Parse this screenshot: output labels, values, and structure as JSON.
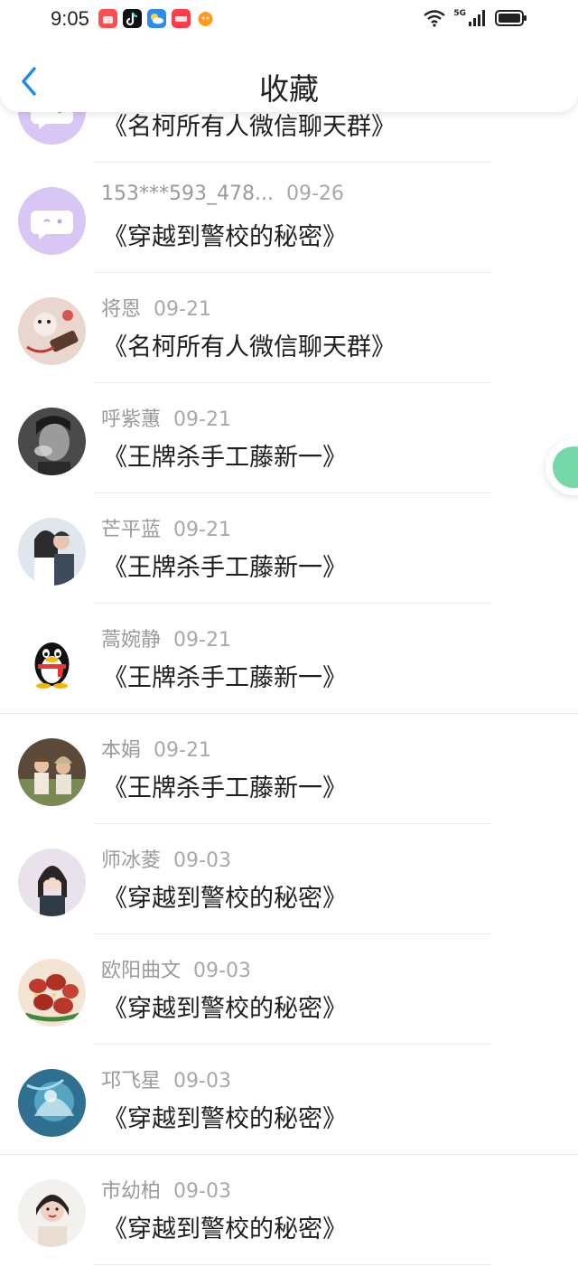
{
  "status_bar": {
    "time": "9:05",
    "network": "5G",
    "apps": [
      {
        "name": "taobao-app-icon",
        "color": "#ff4c4c"
      },
      {
        "name": "tiktok-app-icon",
        "color": "#111111"
      },
      {
        "name": "weather-app-icon",
        "color": "#2b8cf0"
      },
      {
        "name": "tmall-app-icon",
        "color": "#ff3b4a"
      },
      {
        "name": "game-app-icon",
        "color": "#ff9a1f"
      }
    ]
  },
  "header": {
    "title": "收藏"
  },
  "colors": {
    "accent": "#1e8be6",
    "purple_avatar": "#d8c6f5",
    "meta_text": "#9a9a9a"
  },
  "items": [
    {
      "user": "",
      "date": "",
      "text": "《名柯所有人微信聊天群》",
      "avatar": "purple-chat"
    },
    {
      "user": "153***593_478...",
      "date": "09-26",
      "text": "《穿越到警校的秘密》",
      "avatar": "purple-chat"
    },
    {
      "user": "将恩",
      "date": "09-21",
      "text": "《名柯所有人微信聊天群》",
      "avatar": "cartoon"
    },
    {
      "user": "呼紫蕙",
      "date": "09-21",
      "text": "《王牌杀手工藤新一》",
      "avatar": "bw-portrait"
    },
    {
      "user": "芒平蓝",
      "date": "09-21",
      "text": "《王牌杀手工藤新一》",
      "avatar": "couple"
    },
    {
      "user": "蒿婉静",
      "date": "09-21",
      "text": "《王牌杀手工藤新一》",
      "avatar": "qq-penguin"
    },
    {
      "user": "本娟",
      "date": "09-21",
      "text": "《王牌杀手工藤新一》",
      "avatar": "outdoor"
    },
    {
      "user": "师冰菱",
      "date": "09-03",
      "text": "《穿越到警校的秘密》",
      "avatar": "girl-pink"
    },
    {
      "user": "欧阳曲文",
      "date": "09-03",
      "text": "《穿越到警校的秘密》",
      "avatar": "food"
    },
    {
      "user": "邛飞星",
      "date": "09-03",
      "text": "《穿越到警校的秘密》",
      "avatar": "blue-art"
    },
    {
      "user": "市幼柏",
      "date": "09-03",
      "text": "《穿越到警校的秘密》",
      "avatar": "girl-white"
    }
  ]
}
